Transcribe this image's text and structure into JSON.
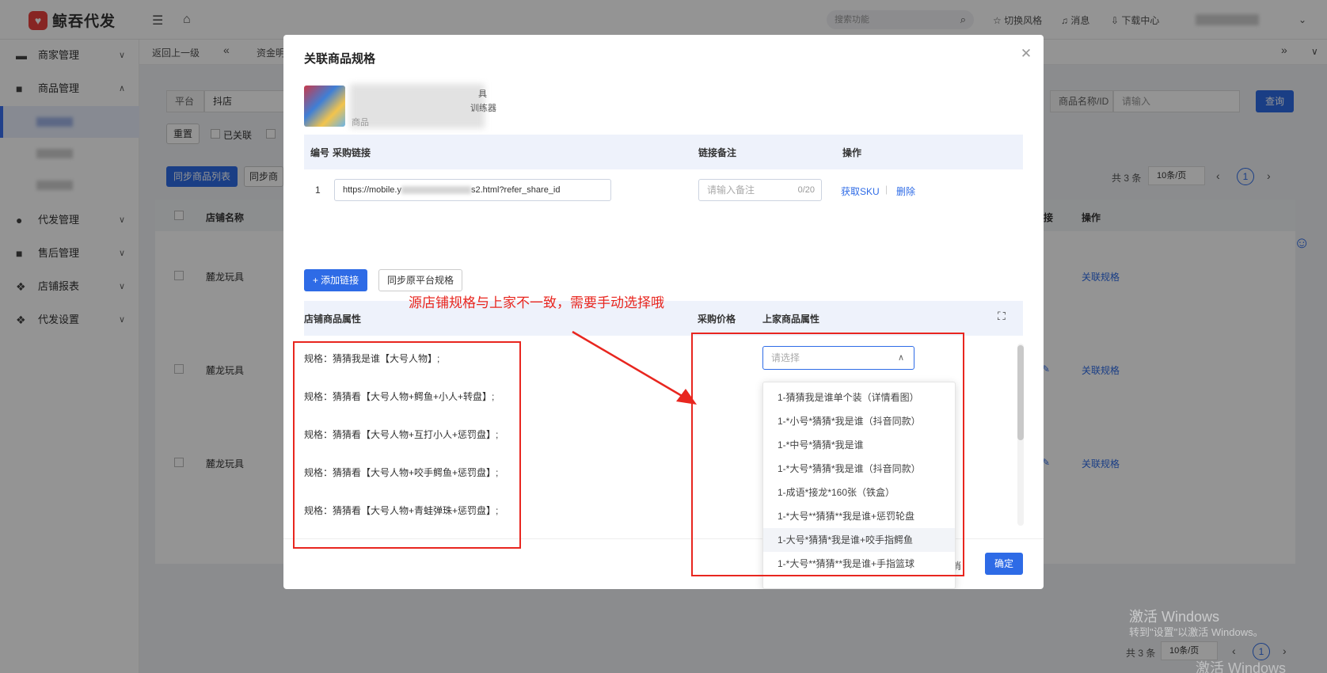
{
  "topbar": {
    "logo_text": "鲸吞代发",
    "search_placeholder": "搜索功能",
    "switch_style": "切换风格",
    "messages": "消息",
    "downloads": "下载中心"
  },
  "sidebar": {
    "items": [
      {
        "label": "商家管理"
      },
      {
        "label": "商品管理"
      },
      {
        "label": "代发管理"
      },
      {
        "label": "售后管理"
      },
      {
        "label": "店铺报表"
      },
      {
        "label": "代发设置"
      }
    ]
  },
  "crumbs": {
    "back": "返回上一级",
    "fund": "资金明"
  },
  "filters": {
    "platform_label": "平台",
    "platform_value": "抖店",
    "product_label": "商品名称/ID",
    "product_placeholder": "请输入",
    "query": "查询",
    "reset": "重置",
    "linked": "已关联",
    "sync_list": "同步商品列表",
    "sync2": "同步商"
  },
  "table": {
    "col_store": "店铺名称",
    "col_link": "链接",
    "col_action": "操作",
    "rows": [
      {
        "store": "麓龙玩具",
        "action": "关联规格"
      },
      {
        "store": "麓龙玩具",
        "action": "关联规格"
      },
      {
        "store": "麓龙玩具",
        "action": "关联规格"
      }
    ]
  },
  "pager": {
    "total": "共 3 条",
    "size": "10条/页",
    "page": "1"
  },
  "modal": {
    "title": "关联商品规格",
    "product_line1": "具",
    "product_line2": "训练器",
    "product_line3": "商品",
    "link_table": {
      "col_no": "编号",
      "col_url": "采购链接",
      "col_remark": "链接备注",
      "col_action": "操作",
      "row": {
        "no": "1",
        "url_prefix": "https://mobile.y",
        "url_suffix": "s2.html?refer_share_id",
        "remark_placeholder": "请输入备注",
        "remark_count": "0/20",
        "get_sku": "获取SKU",
        "delete": "删除"
      }
    },
    "add_link": "+ 添加链接",
    "sync_platform": "同步原平台规格",
    "spec_table": {
      "col_store_attr": "店铺商品属性",
      "col_price": "采购价格",
      "col_supplier_attr": "上家商品属性"
    },
    "specs": [
      "规格：猜猜我是谁【大号人物】;",
      "规格：猜猜看【大号人物+鳄鱼+小人+转盘】;",
      "规格：猜猜看【大号人物+互打小人+惩罚盘】;",
      "规格：猜猜看【大号人物+咬手鳄鱼+惩罚盘】;",
      "规格：猜猜看【大号人物+青蛙弹珠+惩罚盘】;"
    ],
    "select_placeholder": "请选择",
    "options": [
      "1-猜猜我是谁单个装（详情看图）",
      "1-*小号*猜猜*我是谁（抖音同款）",
      "1-*中号*猜猜*我是谁",
      "1-*大号*猜猜*我是谁（抖音同款）",
      "1-成语*接龙*160张（铁盒）",
      "1-*大号**猜猜**我是谁+惩罚轮盘",
      "1-大号*猜猜*我是谁+咬手指鳄鱼",
      "1-*大号**猜猜**我是谁+手指篮球"
    ],
    "cancel": "取消",
    "confirm": "确定",
    "annotation": "源店铺规格与上家不一致，需要手动选择哦"
  },
  "watermark": {
    "line1": "激活 Windows",
    "line2": "转到\"设置\"以激活 Windows。",
    "line3": "激活 Windows"
  },
  "colors": {
    "accent": "#2e6be6",
    "annotation": "#e8261f"
  }
}
